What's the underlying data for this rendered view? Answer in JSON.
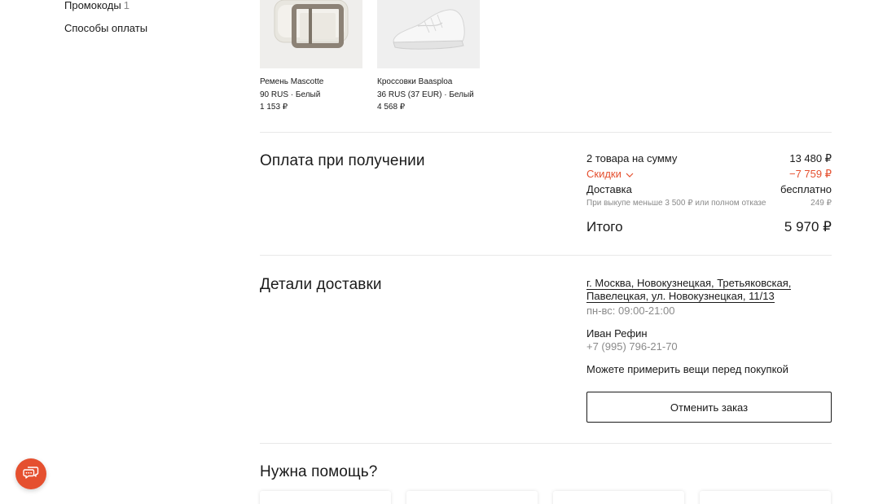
{
  "sidebar": {
    "promo_label": "Промокоды",
    "promo_count": "1",
    "payment_methods_label": "Способы оплаты"
  },
  "products": [
    {
      "name": "Ремень Mascotte",
      "variant": "90 RUS · Белый",
      "price": "1 153 ₽"
    },
    {
      "name": "Кроссовки Baasploa",
      "variant": "36 RUS (37 EUR) · Белый",
      "price": "4 568 ₽"
    }
  ],
  "payment": {
    "title": "Оплата при получении",
    "items_label": "2 товара на сумму",
    "items_value": "13 480 ₽",
    "discounts_label": "Скидки",
    "discounts_value": "−7 759 ₽",
    "delivery_label": "Доставка",
    "delivery_value": "бесплатно",
    "delivery_note": "При выкупе меньше 3 500 ₽ или полном отказе",
    "delivery_note_value": "249 ₽",
    "total_label": "Итого",
    "total_value": "5 970 ₽"
  },
  "delivery": {
    "title": "Детали доставки",
    "address_line1": "г. Москва, Новокузнецкая, Третьяковская,",
    "address_line2": "Павелецкая, ул. Новокузнецкая, 11/13",
    "hours": "пн-вс: 09:00-21:00",
    "recipient_name": "Иван Рефин",
    "recipient_phone": "+7 (995) 796-21-70",
    "try_on_note": "Можете примерить вещи перед покупкой",
    "cancel_button": "Отменить заказ"
  },
  "help": {
    "title": "Нужна помощь?"
  },
  "colors": {
    "accent": "#e5502f",
    "text": "#1a1a1a",
    "muted": "#8a8a8a",
    "divider": "#e8e8e8"
  }
}
